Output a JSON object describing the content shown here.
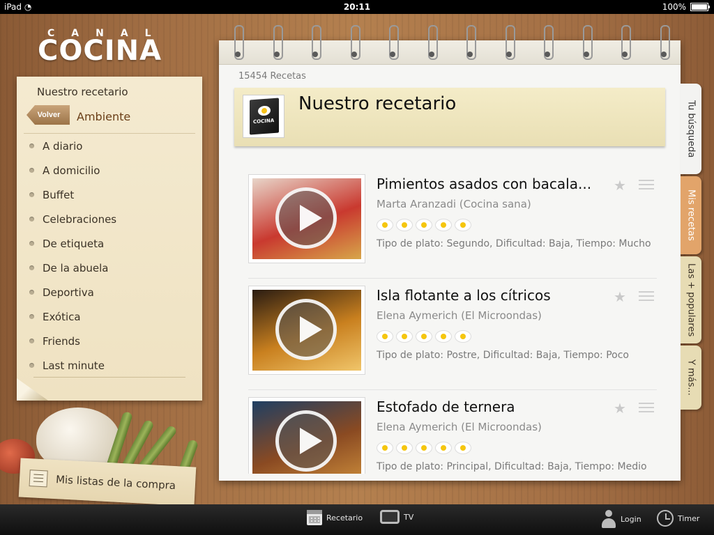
{
  "status_bar": {
    "device": "iPad",
    "time": "20:11",
    "battery": "100%"
  },
  "logo": {
    "top": "CANAL",
    "main": "COCINA"
  },
  "sidebar": {
    "title": "Nuestro recetario",
    "back_label": "Volver",
    "subtitle": "Ambiente",
    "items": [
      {
        "label": "A diario"
      },
      {
        "label": "A domicilio"
      },
      {
        "label": "Buffet"
      },
      {
        "label": "Celebraciones"
      },
      {
        "label": "De etiqueta"
      },
      {
        "label": "De la abuela"
      },
      {
        "label": "Deportiva"
      },
      {
        "label": "Exótica"
      },
      {
        "label": "Friends"
      },
      {
        "label": "Last minute"
      }
    ]
  },
  "shopping_list": {
    "label": "Mis listas de la compra"
  },
  "notebook": {
    "count": "15454 Recetas",
    "banner_title": "Nuestro recetario",
    "banner_icon_label": "COCINA",
    "recipes": [
      {
        "title": "Pimientos asados con bacala...",
        "author": "Marta Aranzadi (Cocina sana)",
        "rating": 5,
        "info": "Tipo de plato: Segundo, Dificultad: Baja, Tiempo: Mucho",
        "thumb_colors": [
          "#e8d5c9",
          "#c9392f",
          "#d7a64a"
        ]
      },
      {
        "title": "Isla flotante a los cítricos",
        "author": "Elena Aymerich (El Microondas)",
        "rating": 5,
        "info": "Tipo de plato: Postre, Dificultad: Baja, Tiempo: Poco",
        "thumb_colors": [
          "#2a1c12",
          "#c9801f",
          "#f0c56a"
        ]
      },
      {
        "title": "Estofado de ternera",
        "author": "Elena Aymerich (El Microondas)",
        "rating": 5,
        "info": "Tipo de plato: Principal, Dificultad: Baja, Tiempo: Medio",
        "thumb_colors": [
          "#1f3f63",
          "#8a4a22",
          "#c98a3a"
        ]
      }
    ]
  },
  "tabs": [
    {
      "label": "Tu búsqueda",
      "color": "#f3f3f1",
      "text_color": "#333333"
    },
    {
      "label": "Mis recetas",
      "color": "#e2a46a",
      "text_color": "#ffffff"
    },
    {
      "label": "Las + populares",
      "color": "#e7dcb4",
      "text_color": "#3b3226"
    },
    {
      "label": "Y más...",
      "color": "#e7dcb4",
      "text_color": "#3b3226"
    }
  ],
  "bottom_bar": {
    "recetario": "Recetario",
    "tv": "TV",
    "login": "Login",
    "timer": "Timer"
  }
}
